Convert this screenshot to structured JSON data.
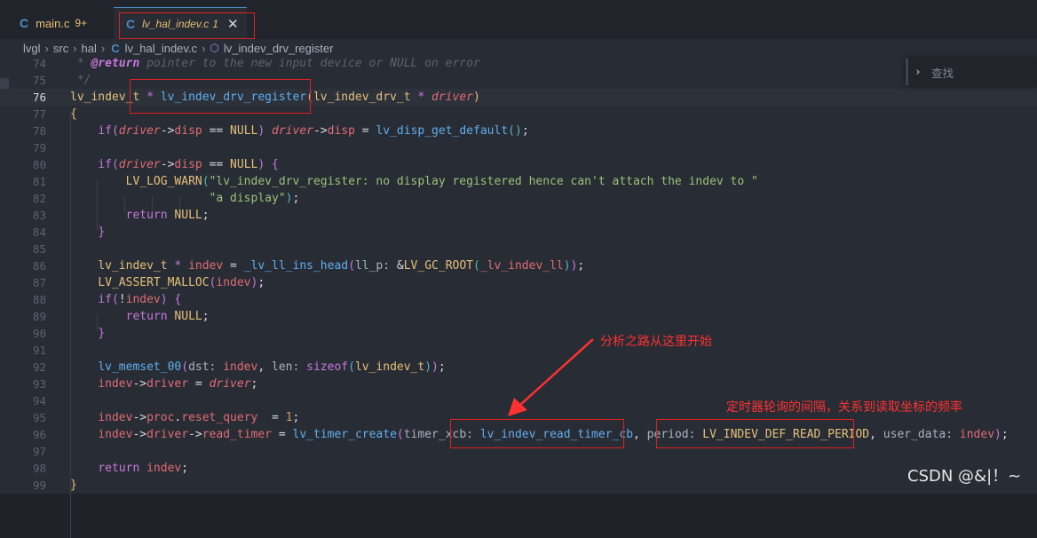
{
  "tabs": [
    {
      "icon": "C",
      "name": "main.c",
      "badge": "9+"
    },
    {
      "icon": "C",
      "name": "lv_hal_indev.c",
      "badge": "1",
      "close": "✕"
    }
  ],
  "breadcrumb": {
    "items": [
      "lvgl",
      "src",
      "hal"
    ],
    "file": "lv_hal_indev.c",
    "symbol": "lv_indev_drv_register"
  },
  "search": {
    "placeholder": "查找"
  },
  "lines": [
    {
      "n": "74",
      "html": "<span class=\"c\"> * <span class=\"k\" style=\"font-style:italic;font-weight:bold\">@return</span> pointer to the new input device or NULL on error</span>"
    },
    {
      "n": "75",
      "html": "<span class=\"c\"> */</span>"
    },
    {
      "n": "76",
      "active": true,
      "html": "<span class=\"t\">lv_indev_t</span> <span class=\"k\">*</span> <span class=\"f\">lv_indev_drv_register</span><span class=\"gold\">(</span><span class=\"t\">lv_indev_drv_t</span> <span class=\"k\">*</span> <span class=\"v it\">driver</span><span class=\"gold\">)</span>"
    },
    {
      "n": "77",
      "html": "<span class=\"gold\">{</span>"
    },
    {
      "n": "78",
      "html": "    <span class=\"k\">if</span><span class=\"k\">(</span><span class=\"v it\">driver</span><span class=\"p\">-&gt;</span><span class=\"v\">disp</span> <span class=\"p\">==</span> <span class=\"t\">NULL</span><span class=\"k\">)</span> <span class=\"v it\">driver</span><span class=\"p\">-&gt;</span><span class=\"v\">disp</span> <span class=\"p\">=</span> <span class=\"f\">lv_disp_get_default</span><span class=\"cy\">()</span><span class=\"p\">;</span>"
    },
    {
      "n": "79",
      "html": ""
    },
    {
      "n": "80",
      "html": "    <span class=\"k\">if</span><span class=\"k\">(</span><span class=\"v it\">driver</span><span class=\"p\">-&gt;</span><span class=\"v\">disp</span> <span class=\"p\">==</span> <span class=\"t\">NULL</span><span class=\"k\">)</span> <span class=\"k\">{</span>"
    },
    {
      "n": "81",
      "html": "        <span class=\"t\">LV_LOG_WARN</span><span class=\"cy\">(</span><span class=\"s\">\"lv_indev_drv_register: no display registered hence can't attach the indev to \"</span>"
    },
    {
      "n": "82",
      "html": "                    <span class=\"s\">\"a display\"</span><span class=\"cy\">)</span><span class=\"p\">;</span>"
    },
    {
      "n": "83",
      "html": "        <span class=\"k\">return</span> <span class=\"t\">NULL</span><span class=\"p\">;</span>"
    },
    {
      "n": "84",
      "html": "    <span class=\"k\">}</span>"
    },
    {
      "n": "85",
      "html": ""
    },
    {
      "n": "86",
      "html": "    <span class=\"t\">lv_indev_t</span> <span class=\"k\">*</span> <span class=\"v\">indev</span> <span class=\"p\">=</span> <span class=\"f\">_lv_ll_ins_head</span><span class=\"k\">(</span><span class=\"hint\">ll_p: </span><span class=\"p\">&amp;</span><span class=\"t\">LV_GC_ROOT</span><span class=\"cy\">(</span><span class=\"v\">_lv_indev_ll</span><span class=\"cy\">)</span><span class=\"k\">)</span><span class=\"p\">;</span>"
    },
    {
      "n": "87",
      "html": "    <span class=\"t\">LV_ASSERT_MALLOC</span><span class=\"k\">(</span><span class=\"v\">indev</span><span class=\"k\">)</span><span class=\"p\">;</span>"
    },
    {
      "n": "88",
      "html": "    <span class=\"k\">if</span><span class=\"k\">(</span><span class=\"p\">!</span><span class=\"v\">indev</span><span class=\"k\">)</span> <span class=\"k\">{</span>"
    },
    {
      "n": "89",
      "html": "        <span class=\"k\">return</span> <span class=\"t\">NULL</span><span class=\"p\">;</span>"
    },
    {
      "n": "90",
      "html": "    <span class=\"k\">}</span>"
    },
    {
      "n": "91",
      "html": ""
    },
    {
      "n": "92",
      "html": "    <span class=\"f\">lv_memset_00</span><span class=\"k\">(</span><span class=\"hint\">dst: </span><span class=\"v\">indev</span><span class=\"p\">,</span> <span class=\"hint\">len: </span><span class=\"k\">sizeof</span><span class=\"cy\">(</span><span class=\"t\">lv_indev_t</span><span class=\"cy\">)</span><span class=\"k\">)</span><span class=\"p\">;</span>"
    },
    {
      "n": "93",
      "html": "    <span class=\"v\">indev</span><span class=\"p\">-&gt;</span><span class=\"v\">driver</span> <span class=\"p\">=</span> <span class=\"v it\">driver</span><span class=\"p\">;</span>"
    },
    {
      "n": "94",
      "html": ""
    },
    {
      "n": "95",
      "html": "    <span class=\"v\">indev</span><span class=\"p\">-&gt;</span><span class=\"v\">proc</span><span class=\"p\">.</span><span class=\"v\">reset_query</span>  <span class=\"p\">=</span> <span class=\"n\">1</span><span class=\"p\">;</span>"
    },
    {
      "n": "96",
      "html": "    <span class=\"v\">indev</span><span class=\"p\">-&gt;</span><span class=\"v\">driver</span><span class=\"p\">-&gt;</span><span class=\"v\">read_timer</span> <span class=\"p\">=</span> <span class=\"f\">lv_timer_create</span><span class=\"k\">(</span><span class=\"hint\">timer_xcb: </span><span class=\"f\">lv_indev_read_timer_cb</span><span class=\"p\">,</span> <span class=\"hint\">period: </span><span class=\"t\">LV_INDEV_DEF_READ_PERIOD</span><span class=\"p\">,</span> <span class=\"hint\">user_data: </span><span class=\"v\">indev</span><span class=\"k\">)</span><span class=\"p\">;</span>"
    },
    {
      "n": "97",
      "html": ""
    },
    {
      "n": "98",
      "html": "    <span class=\"k\">return</span> <span class=\"v\">indev</span><span class=\"p\">;</span>"
    },
    {
      "n": "99",
      "html": "<span class=\"gold\">}</span>"
    }
  ],
  "annotations": {
    "arrow_text": "分析之路从这里开始",
    "timer_text": "定时器轮询的间隔，关系到读取坐标的频率"
  },
  "watermark": "CSDN @&|！~",
  "colors": {
    "accent": "#4f8cc9",
    "annotation": "#ff3131"
  }
}
